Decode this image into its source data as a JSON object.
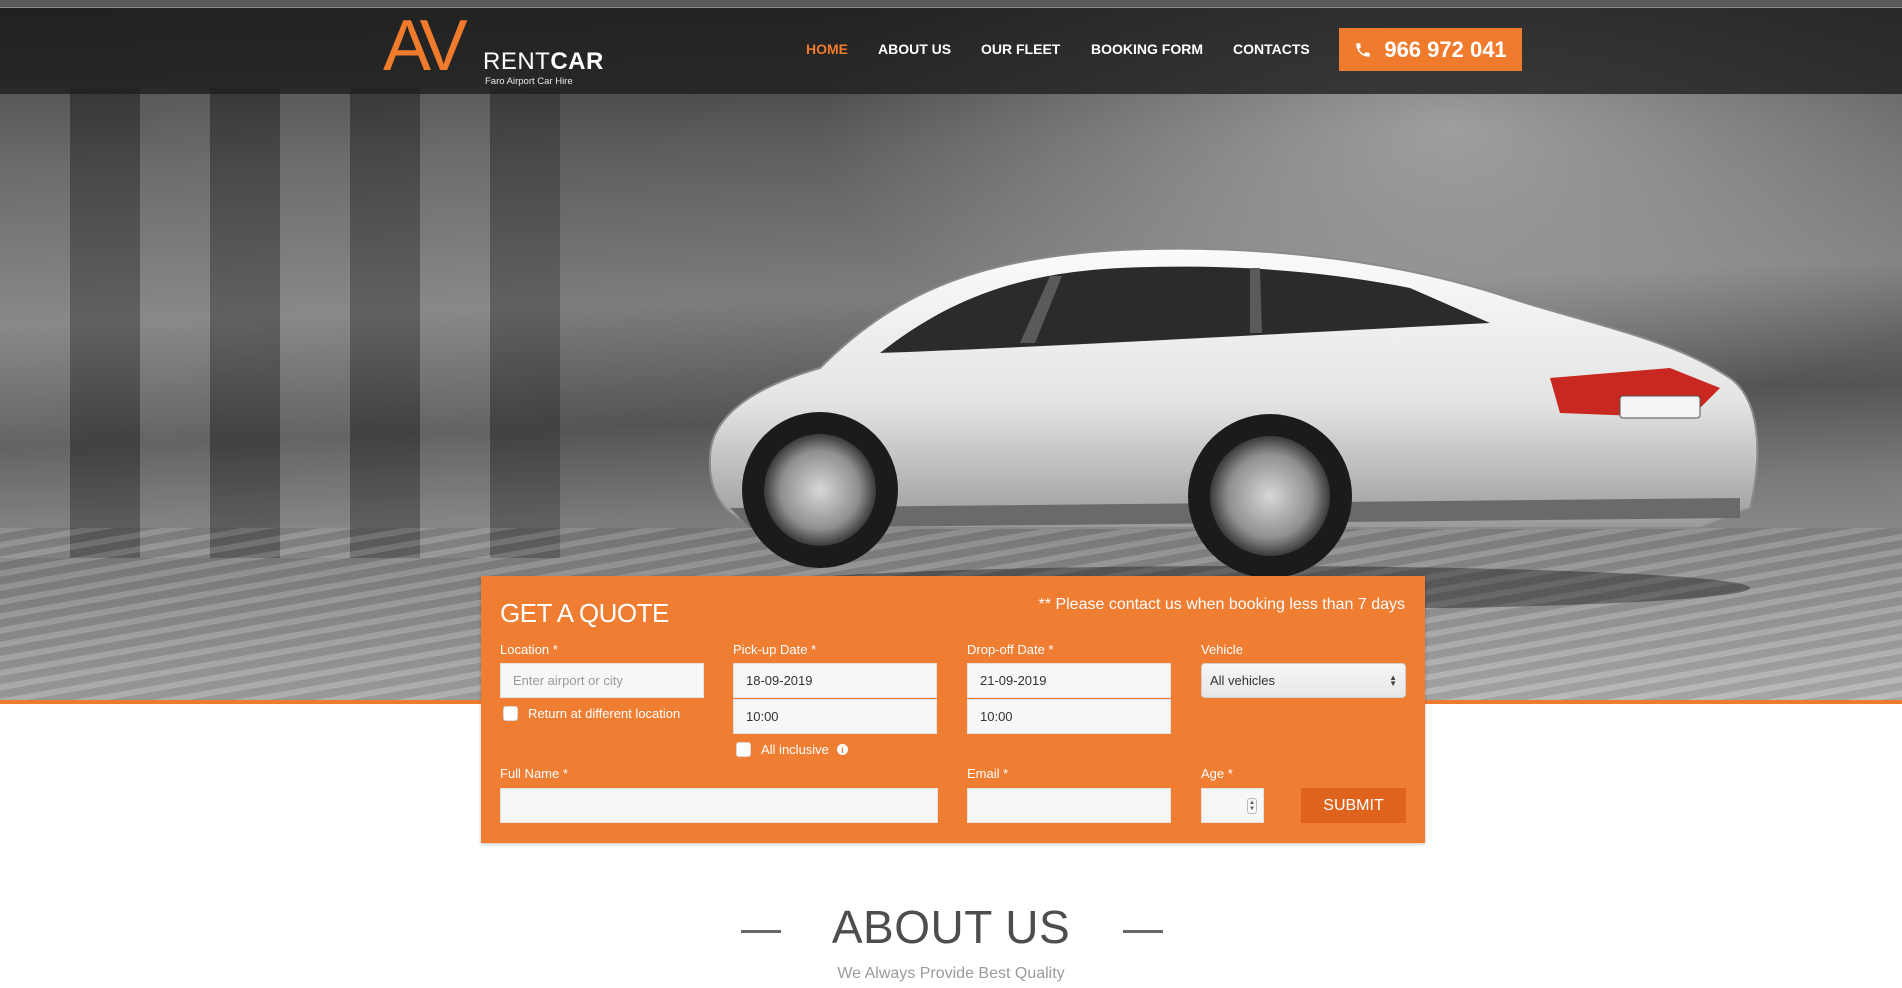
{
  "brand": {
    "logo_mark": "AV",
    "name_light": "RENT",
    "name_bold": "CAR",
    "tagline": "Faro Airport Car Hire",
    "accent": "#f07b2c"
  },
  "nav": {
    "items": [
      {
        "label": "HOME",
        "active": true
      },
      {
        "label": "ABOUT US",
        "active": false
      },
      {
        "label": "OUR FLEET",
        "active": false
      },
      {
        "label": "BOOKING FORM",
        "active": false
      },
      {
        "label": "CONTACTS",
        "active": false
      }
    ],
    "phone": "966 972 041",
    "phone_icon": "phone-icon"
  },
  "quote": {
    "title": "GET A QUOTE",
    "note": "** Please contact us when booking less than 7 days",
    "location": {
      "label": "Location *",
      "placeholder": "Enter airport or city",
      "value": ""
    },
    "return_different": {
      "label": "Return at different location",
      "checked": false
    },
    "pickup": {
      "label": "Pick-up Date *",
      "date": "18-09-2019",
      "time": "10:00"
    },
    "all_inclusive": {
      "label": "All inclusive",
      "checked": false,
      "icon": "info-icon"
    },
    "dropoff": {
      "label": "Drop-off Date *",
      "date": "21-09-2019",
      "time": "10:00"
    },
    "vehicle": {
      "label": "Vehicle",
      "selected": "All vehicles"
    },
    "full_name": {
      "label": "Full Name *",
      "value": ""
    },
    "email": {
      "label": "Email *",
      "value": ""
    },
    "age": {
      "label": "Age *",
      "value": ""
    },
    "submit": "SUBMIT"
  },
  "about": {
    "title": "ABOUT US",
    "subtitle": "We Always Provide Best Quality"
  },
  "colors": {
    "panel": "#ef7d32",
    "submit": "#e0631d",
    "header_bg": "#2a2a2a"
  }
}
